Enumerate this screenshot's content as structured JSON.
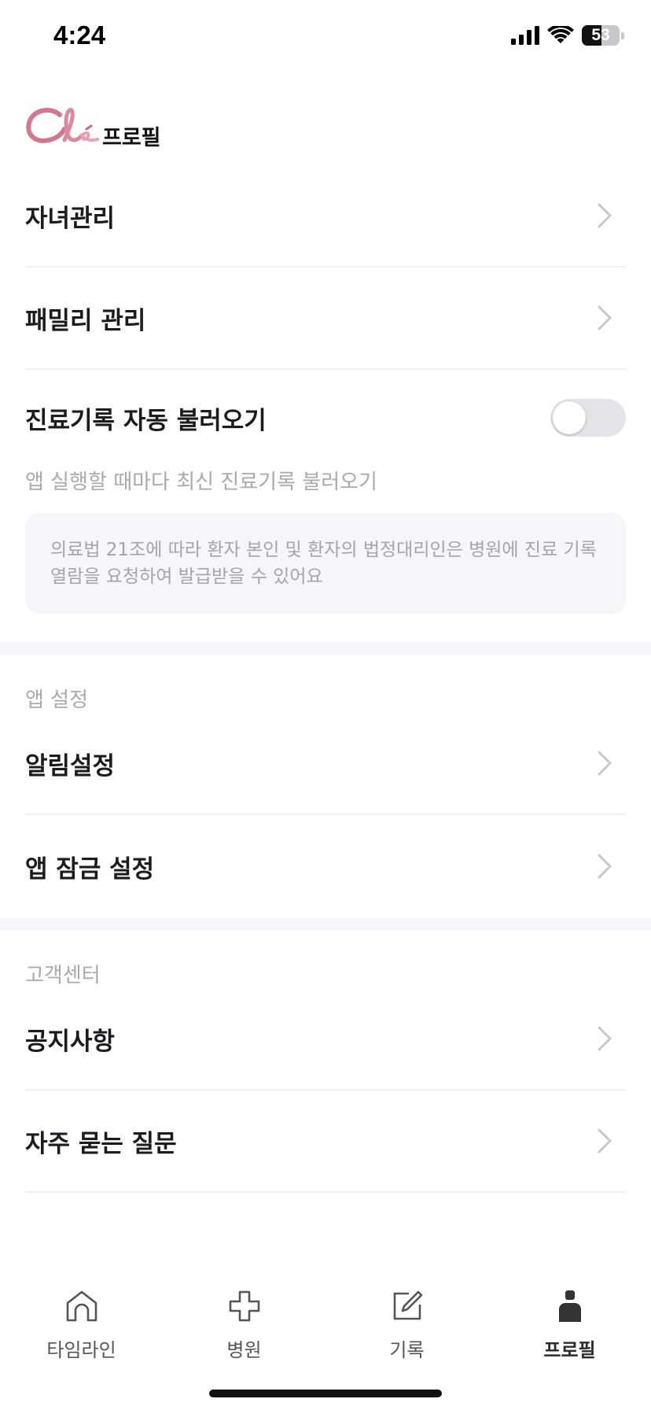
{
  "status_bar": {
    "time": "4:24",
    "battery": "53"
  },
  "header": {
    "title": "프로필"
  },
  "profile_menu": [
    {
      "label": "자녀관리"
    },
    {
      "label": "패밀리 관리"
    }
  ],
  "records_sync": {
    "label": "진료기록 자동 불러오기",
    "enabled": false,
    "description": "앱 실행할 때마다 최신 진료기록 불러오기",
    "notice": "의료법 21조에 따라 환자 본인 및 환자의 법정대리인은 병원에 진료 기록 열람을 요청하여 발급받을 수 있어요"
  },
  "app_settings": {
    "header": "앱 설정",
    "items": [
      {
        "label": "알림설정"
      },
      {
        "label": "앱 잠금 설정"
      }
    ]
  },
  "support": {
    "header": "고객센터",
    "items": [
      {
        "label": "공지사항"
      },
      {
        "label": "자주 묻는 질문"
      }
    ]
  },
  "tab_bar": {
    "tabs": [
      {
        "label": "타임라인",
        "icon": "home-icon"
      },
      {
        "label": "병원",
        "icon": "plus-cross-icon"
      },
      {
        "label": "기록",
        "icon": "edit-icon"
      },
      {
        "label": "프로필",
        "icon": "person-icon",
        "active": true
      }
    ]
  },
  "colors": {
    "accent_logo": "#d4778e",
    "toggle_off": "#e4e4e8",
    "section_bg": "#f6f6f8"
  }
}
